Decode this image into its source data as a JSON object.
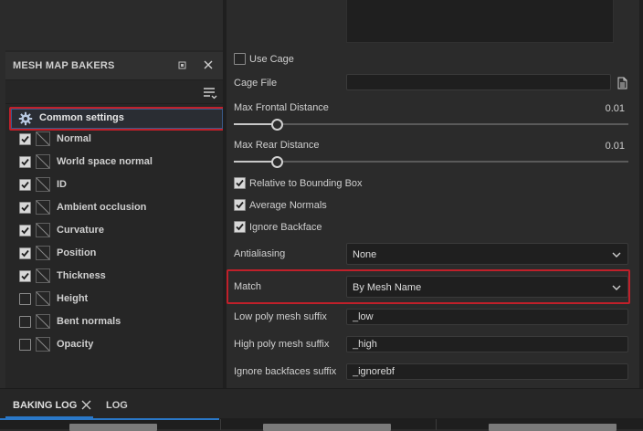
{
  "left_panel": {
    "title": "MESH MAP BAKERS",
    "common_settings_label": "Common settings",
    "bakers": [
      {
        "label": "Normal",
        "checked": true
      },
      {
        "label": "World space normal",
        "checked": true
      },
      {
        "label": "ID",
        "checked": true
      },
      {
        "label": "Ambient occlusion",
        "checked": true
      },
      {
        "label": "Curvature",
        "checked": true
      },
      {
        "label": "Position",
        "checked": true
      },
      {
        "label": "Thickness",
        "checked": true
      },
      {
        "label": "Height",
        "checked": false
      },
      {
        "label": "Bent normals",
        "checked": false
      },
      {
        "label": "Opacity",
        "checked": false
      }
    ]
  },
  "settings": {
    "use_cage_label": "Use Cage",
    "use_cage_checked": false,
    "cage_file_label": "Cage File",
    "cage_file_value": "",
    "max_frontal_label": "Max Frontal Distance",
    "max_frontal_value": "0.01",
    "max_frontal_level": 0.01,
    "max_rear_label": "Max Rear Distance",
    "max_rear_value": "0.01",
    "max_rear_level": 0.01,
    "relative_bbox_label": "Relative to Bounding Box",
    "relative_bbox_checked": true,
    "average_normals_label": "Average Normals",
    "average_normals_checked": true,
    "ignore_backface_label": "Ignore Backface",
    "ignore_backface_checked": true,
    "antialiasing_label": "Antialiasing",
    "antialiasing_value": "None",
    "match_label": "Match",
    "match_value": "By Mesh Name",
    "low_poly_suffix_label": "Low poly mesh suffix",
    "low_poly_suffix_value": "_low",
    "high_poly_suffix_label": "High poly mesh suffix",
    "high_poly_suffix_value": "_high",
    "ignore_backfaces_suffix_label": "Ignore backfaces suffix",
    "ignore_backfaces_suffix_value": "_ignorebf"
  },
  "bottom_tabs": {
    "baking_log_label": "BAKING LOG",
    "log_label": "LOG"
  },
  "icons": {
    "panel_float": "float-window-icon",
    "panel_close": "close-icon",
    "filter": "filter-icon",
    "gear": "gear-icon",
    "file_browse": "file-icon",
    "dropdown": "chevron-down-icon"
  },
  "colors": {
    "highlight_border": "#c0202a",
    "accent_blue": "#2a78c8"
  }
}
